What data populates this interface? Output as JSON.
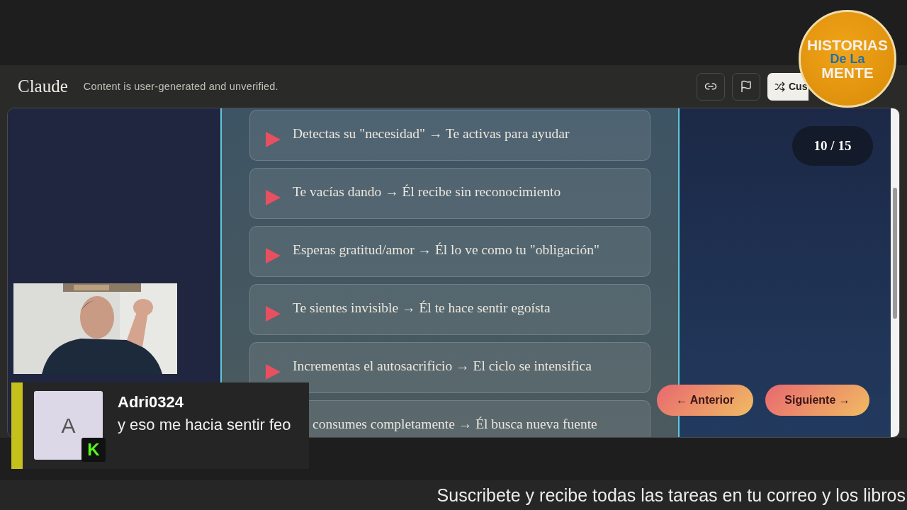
{
  "header": {
    "title": "Claude",
    "notice": "Content is user-generated and unverified.",
    "buttons": [
      {
        "kind": "link"
      },
      {
        "kind": "flag"
      },
      {
        "kind": "customize",
        "label": "Cus"
      }
    ]
  },
  "slides": {
    "counter": "10 / 15",
    "items": [
      {
        "text": "Detectas su \"necesidad\" → Te activas para ayudar",
        "partial": false
      },
      {
        "text": "Te vacías dando → Él recibe sin reconocimiento",
        "partial": false
      },
      {
        "text": "Esperas gratitud/amor → Él lo ve como tu \"obligación\"",
        "partial": false
      },
      {
        "text": "Te sientes invisible → Él te hace sentir egoísta",
        "partial": false
      },
      {
        "text": "Incrementas el autosacrificio → El ciclo se intensifica",
        "partial": false
      },
      {
        "text": "consumes completamente → Él busca nueva fuente",
        "partial": true
      }
    ],
    "prev": "← Anterior",
    "next": "Siguiente →"
  },
  "chat": {
    "user": "Adri0324",
    "message": "y eso me hacia sentir feo",
    "avatar": "A",
    "badge": "K"
  },
  "logo": {
    "lines": [
      "HISTORIAS",
      "De La",
      "MENTE"
    ]
  },
  "ticker": "Suscribete y recibe todas las tareas en tu correo y los libros"
}
